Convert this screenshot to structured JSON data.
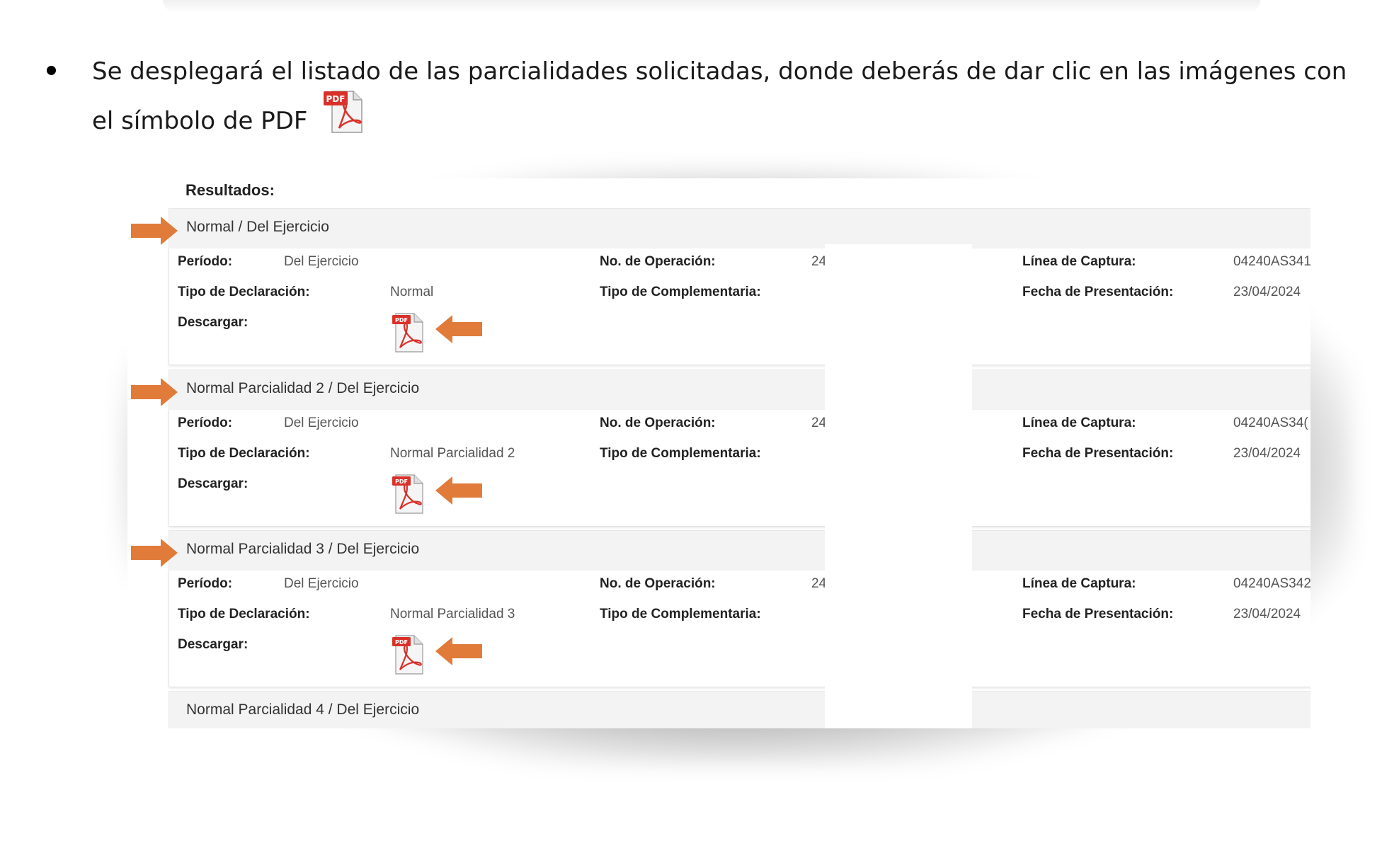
{
  "instruction": {
    "text": "Se desplegará el listado de las parcialidades solicitadas, donde deberás de dar clic en las imágenes con el símbolo de PDF"
  },
  "panel": {
    "title": "Resultados:",
    "labels": {
      "periodo": "Período:",
      "tipo_declaracion": "Tipo de Declaración:",
      "descargar": "Descargar:",
      "no_operacion": "No. de Operación:",
      "tipo_complementaria": "Tipo de Complementaria:",
      "linea_captura": "Línea de Captura:",
      "fecha_presentacion": "Fecha de Presentación:"
    },
    "sections": [
      {
        "title": "Normal / Del Ejercicio",
        "periodo": "Del Ejercicio",
        "tipo": "Normal",
        "operacion": "24",
        "linea": "04240AS341",
        "fecha": "23/04/2024"
      },
      {
        "title": "Normal Parcialidad 2 / Del Ejercicio",
        "periodo": "Del Ejercicio",
        "tipo": "Normal Parcialidad 2",
        "operacion": "24",
        "linea": "04240AS34(",
        "fecha": "23/04/2024"
      },
      {
        "title": "Normal Parcialidad 3 / Del Ejercicio",
        "periodo": "Del Ejercicio",
        "tipo": "Normal Parcialidad 3",
        "operacion": "24",
        "linea": "04240AS342",
        "fecha": "23/04/2024"
      },
      {
        "title": "Normal Parcialidad 4 / Del Ejercicio"
      }
    ]
  },
  "icons": {
    "pdf": "pdf-icon",
    "arrow": "orange-arrow-icon",
    "pdf_badge": "PDF"
  },
  "colors": {
    "arrow": "#e07b39",
    "pdf_red": "#d9312a"
  }
}
